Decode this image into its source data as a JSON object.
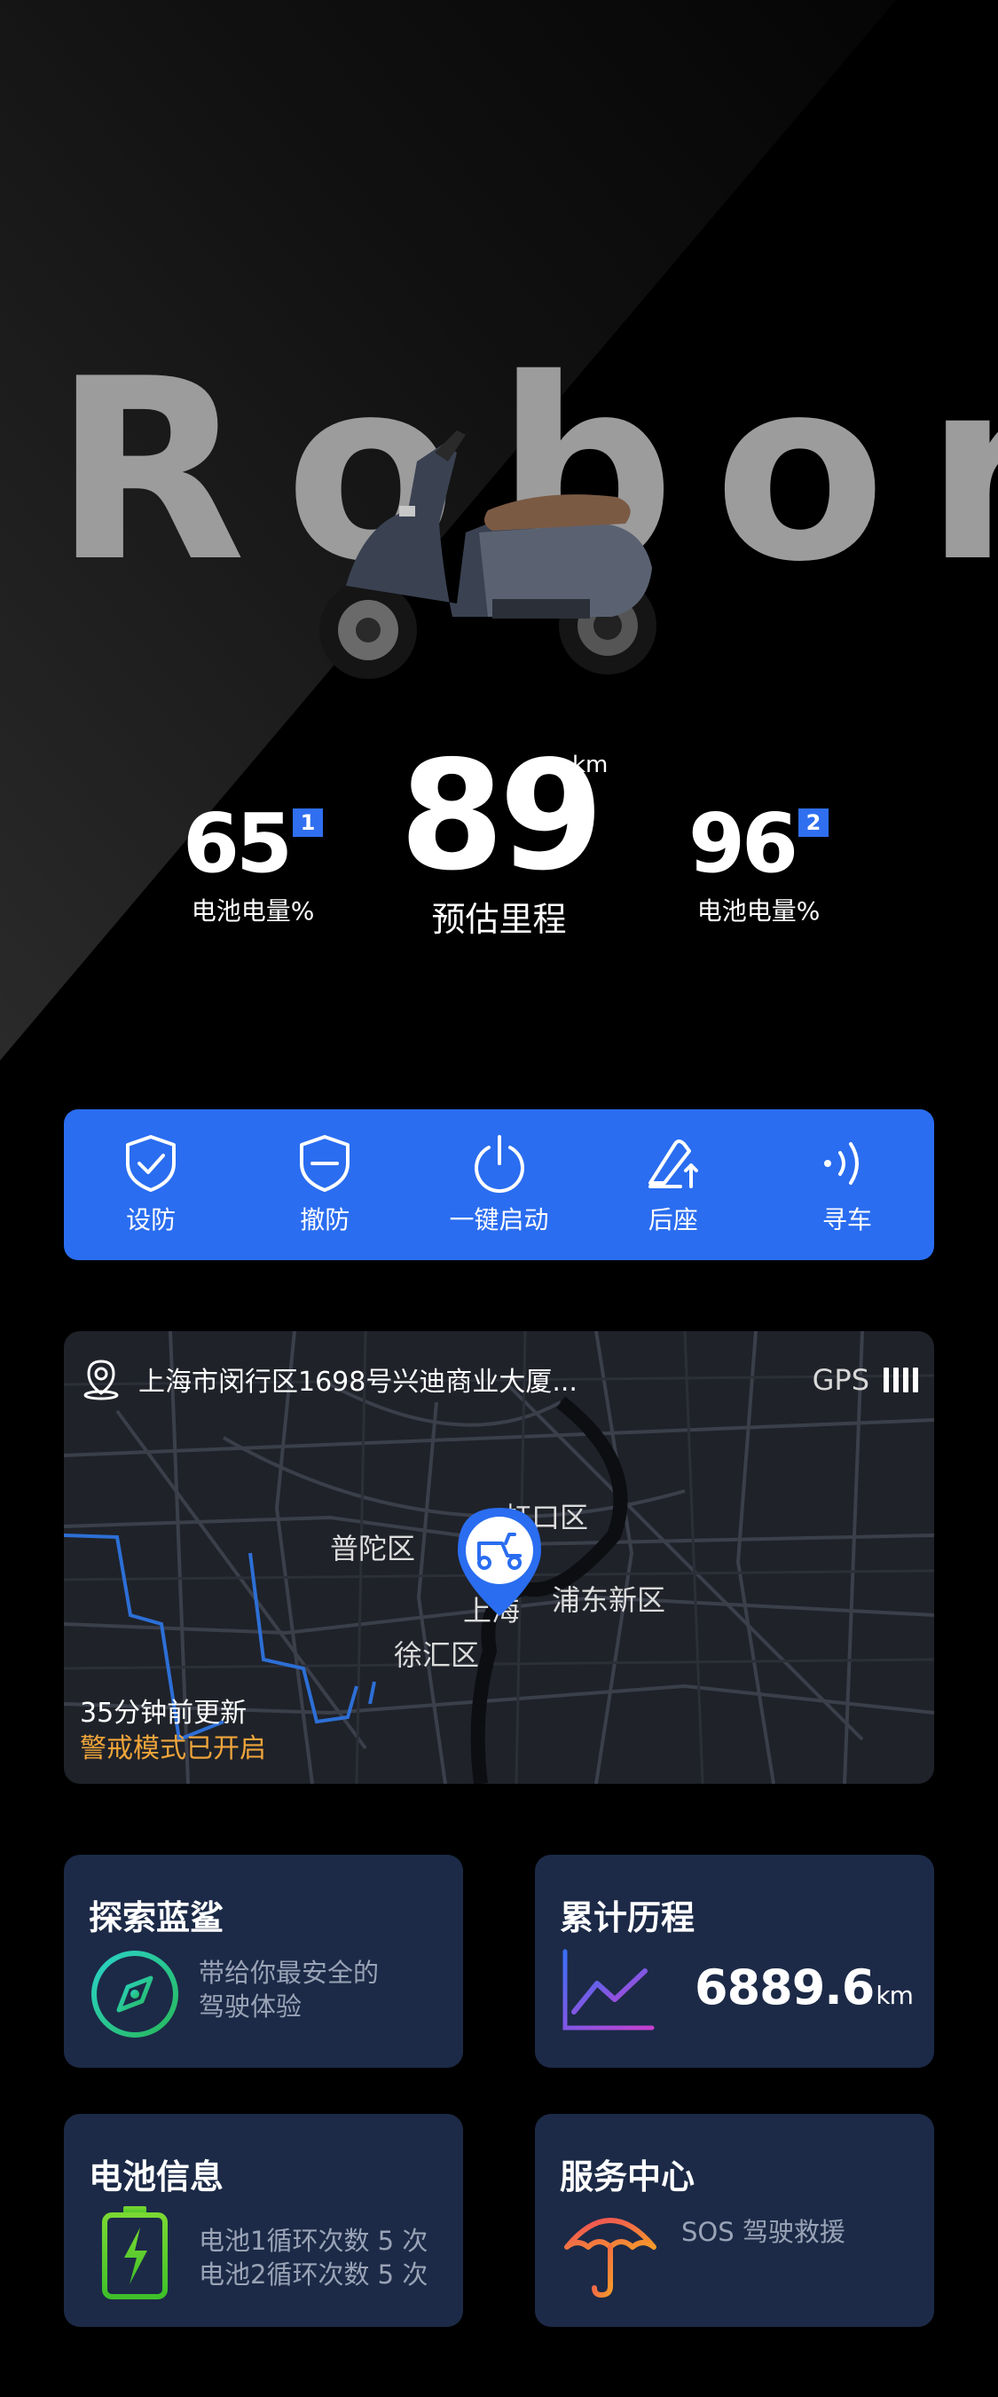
{
  "hero": {
    "brand": "Robor",
    "battery1": {
      "value": "65",
      "badge": "1",
      "caption": "电池电量%"
    },
    "range": {
      "value": "89",
      "unit": "km",
      "caption": "预估里程"
    },
    "battery2": {
      "value": "96",
      "badge": "2",
      "caption": "电池电量%"
    }
  },
  "actions": [
    {
      "label": "设防",
      "icon": "shield-check-icon"
    },
    {
      "label": "撤防",
      "icon": "shield-minus-icon"
    },
    {
      "label": "一键启动",
      "icon": "power-icon"
    },
    {
      "label": "后座",
      "icon": "seat-lift-icon"
    },
    {
      "label": "寻车",
      "icon": "signal-waves-icon"
    }
  ],
  "map": {
    "address": "上海市闵行区1698号兴迪商业大厦...",
    "gps_label": "GPS",
    "gps_signal_bars": 4,
    "districts": [
      "普陀区",
      "虹口区",
      "浦东新区",
      "上海",
      "徐汇区"
    ],
    "updated": "35分钟前更新",
    "alert": "警戒模式已开启"
  },
  "cards": {
    "explore": {
      "title": "探索蓝鲨",
      "line1": "带给你最安全的",
      "line2": "驾驶体验"
    },
    "mileage": {
      "title": "累计历程",
      "value": "6889.6",
      "unit": "km"
    },
    "battery": {
      "title": "电池信息",
      "line1": "电池1循环次数 5 次",
      "line2": "电池2循环次数 5 次"
    },
    "service": {
      "title": "服务中心",
      "line1": "SOS 驾驶救援"
    }
  },
  "colors": {
    "accent": "#2a6df0",
    "card": "#1c2a47",
    "alert": "#f0a53a",
    "background": "#000000"
  }
}
